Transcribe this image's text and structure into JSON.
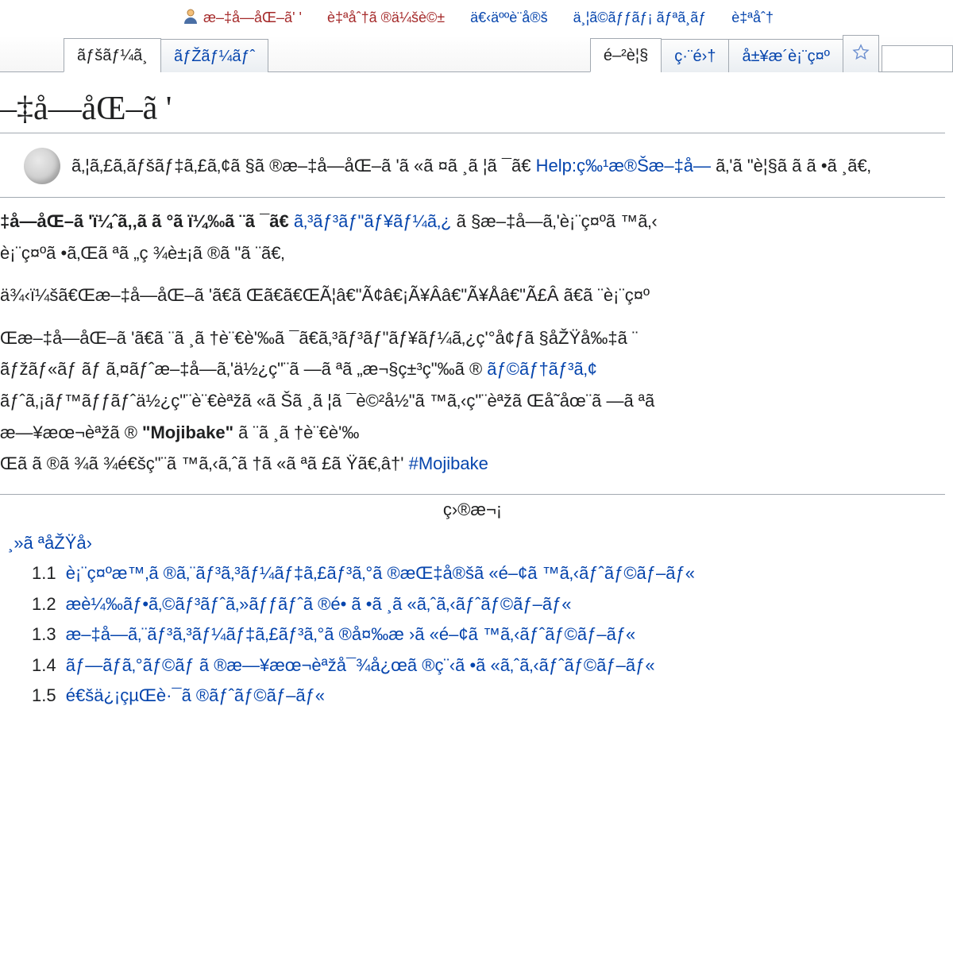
{
  "userbar": {
    "username": "æ–‡å­—åŒ–ã' '",
    "talk": "è‡ªåˆ†ã ®ä¼šè©±",
    "sandbox": "ä€‹äººè¨­å®š",
    "prefs": "ä¸¦ã©ãƒƒãƒ¡ ãƒªã¸ãƒ",
    "beta": "è‡ªåˆ†"
  },
  "tabs_left": {
    "t0": "ãƒšãƒ¼ã¸",
    "t1": "ãƒŽãƒ¼ãƒˆ"
  },
  "tabs_right": {
    "r0": "é–²è¦§",
    "r1": "ç·¨é›†",
    "r2": "å±¥æ­´è¡¨ç¤º"
  },
  "search": {
    "placeholder": ""
  },
  "title": "–‡å­—åŒ–ã '",
  "hatnote": {
    "pre": "ã‚¦ã‚£ã‚­ãƒšãƒ‡ã‚£ã‚¢ã §ã ®æ–‡å­—åŒ–ã 'ã «ã ¤ã ¸ã ¦ã ¯ã€",
    "link": "Help:ç‰¹æ®Šæ–‡å­—",
    "post": "ã‚'ã \"è¦§ã  ã ã •ã ¸ã€‚"
  },
  "body": {
    "p1_a": "‡å­—åŒ–ã 'ï¼ˆã‚‚ã ã °ã ï¼‰ã ¨ã ¯ã€",
    "p1_link": "ã‚³ãƒ³ãƒ\"ãƒ¥ãƒ¼ã‚¿",
    "p1_b": "ã §æ–‡å­—ã‚'è¡¨ç¤ºã ™ã‚‹",
    "p1_c": "è¡¨ç¤ºã •ã‚Œã ªã „ç ¾è±¡ã ®ã \"ã ¨ã€‚",
    "p2": "ä¾‹ï¼šã€Œæ–‡å­—åŒ–ã 'ã€ã Œã€ã€ŒÃ¦â€\"Ã¢â€¡Ã¥Â­â€\"Ã¥Åâ€\"Ã£Â ã€ã ¨è¡¨ç¤º",
    "p3_a": "Œæ–‡å­—åŒ–ã 'ã€ã ¨ã ¸ã †è¨€è'‰ã ¯ã€ã‚³ãƒ³ãƒ\"ãƒ¥ãƒ¼ã‚¿ç'°å¢ƒã §åŽŸå‰‡ã ¨",
    "p3_b": "ãƒžãƒ«ãƒ ãƒ ã‚¤ãƒˆæ–‡å­—ã‚'ä½¿ç\"¨ã —ã ªã „æ¬§ç±³ç\"‰ã ®",
    "p3_link1": "ãƒ©ãƒ†ãƒ³ã‚¢",
    "p3_c": "ãƒˆã‚¡ãƒ™ãƒƒãƒˆä½¿ç\"¨è¨€èªžã «ã Šã ¸ã ¦ã ¯è©²å½\"ã ™ã‚‹ç\"¨èªžã Œå­˜åœ¨ã —ã ªã",
    "p3_d": "æ—¥æœ¬èªžã ®",
    "p3_boldword": "\"Mojibake\"",
    "p3_e": "ã ¨ã ¸ã †è¨€è'‰",
    "p3_f": "Œã  ã ®ã ¾ã ¾é€šç\"¨ã ™ã‚‹ã‚ˆã †ã «ã ªã £ã Ÿã€‚â†'",
    "p3_link2": "#Mojibake"
  },
  "toc": {
    "heading": "ç›®æ¬¡",
    "i1": "¸»ã ªåŽŸå›",
    "i1_1": "è¡¨ç¤ºæ™‚ã ®ã‚¨ãƒ³ã‚³ãƒ¼ãƒ‡ã‚£ãƒ³ã‚°ã ®æŒ‡å®šã «é–¢ã ™ã‚‹ãƒˆãƒ©ãƒ–ãƒ«",
    "i1_2": "æ­è¼‰ãƒ•ã‚©ãƒ³ãƒˆã‚»ãƒƒãƒˆã ®é• ã •ã ¸ã «ã‚ˆã‚‹ãƒˆãƒ©ãƒ–ãƒ«",
    "i1_3": "æ–‡å­—ã‚¨ãƒ³ã‚³ãƒ¼ãƒ‡ã‚£ãƒ³ã‚°ã ®å¤‰æ ›ã «é–¢ã ™ã‚‹ãƒˆãƒ©ãƒ–ãƒ«",
    "i1_4": "ãƒ—ãƒ­ã‚°ãƒ©ãƒ ã ®æ—¥æœ¬èªžå¯¾å¿œã ®ç¨‹ã •ã «ã‚ˆã‚‹ãƒˆãƒ©ãƒ–ãƒ«",
    "i1_5": "é€šä¿¡çµŒè·¯ã ®ãƒˆãƒ©ãƒ–ãƒ«"
  }
}
